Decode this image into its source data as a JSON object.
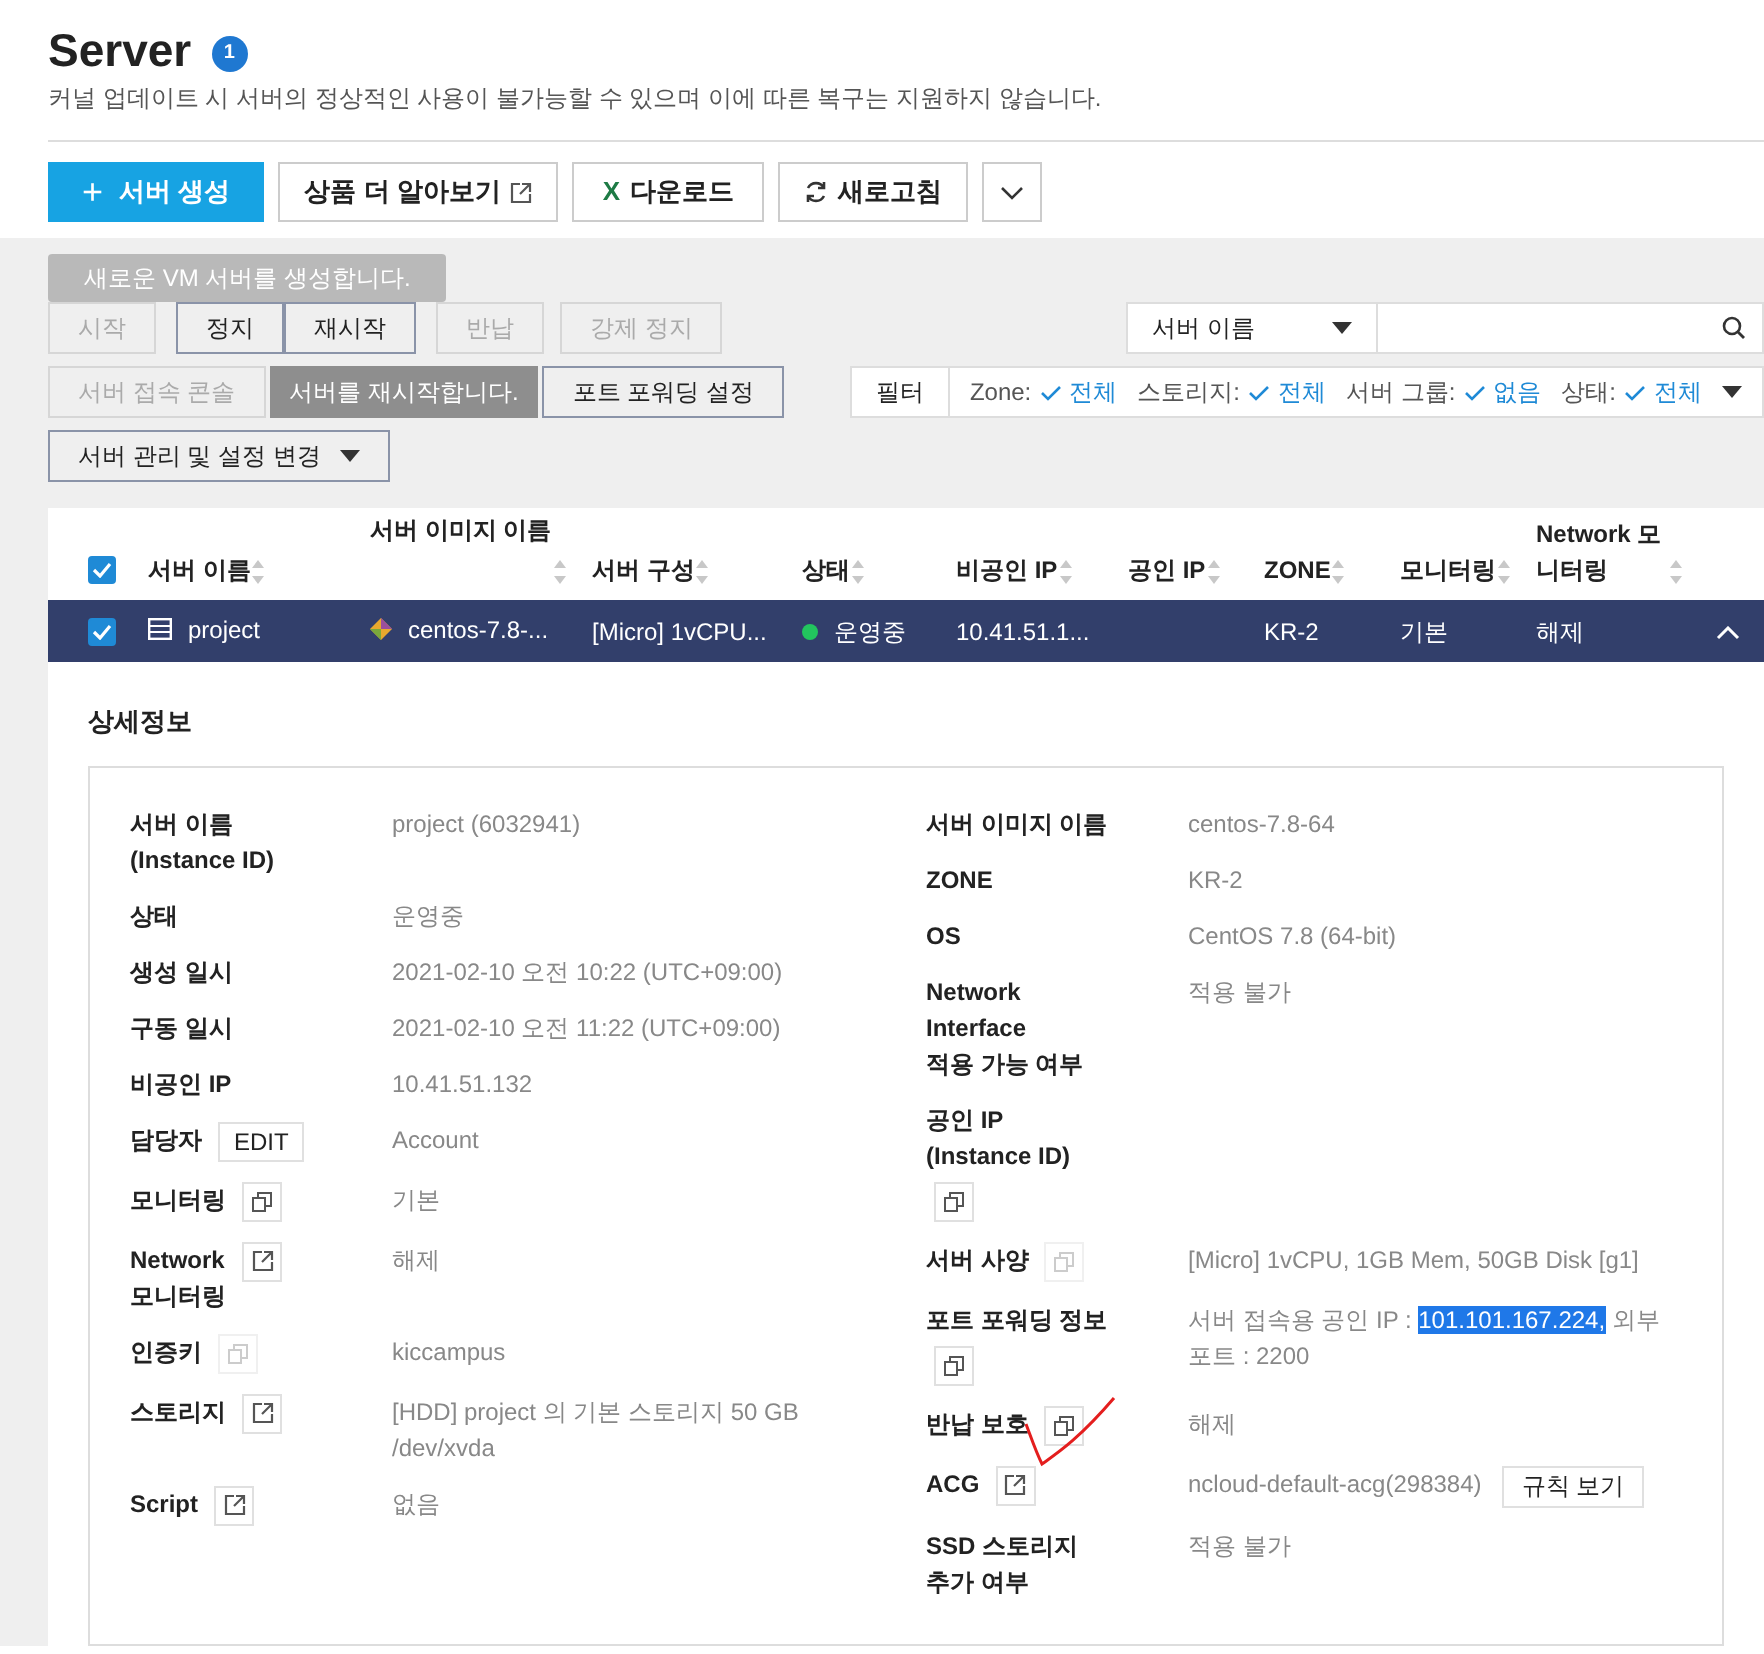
{
  "header": {
    "title": "Server",
    "badge": "1",
    "subtitle": "커널 업데이트 시 서버의 정상적인 사용이 불가능할 수 있으며 이에 따른 복구는 지원하지 않습니다."
  },
  "toolbar": [
    {
      "kind": "primary",
      "icon": "+",
      "label": "서버 생성"
    },
    {
      "kind": "external",
      "label": "상품 더 알아보기"
    },
    {
      "kind": "excel",
      "icon": "X",
      "label": "다운로드"
    },
    {
      "kind": "refresh",
      "label": "새로고침"
    },
    {
      "kind": "caret"
    }
  ],
  "tooltip": "새로운 VM 서버를 생성합니다.",
  "actions": [
    [
      {
        "label": "시작",
        "disabled": true
      },
      {
        "label": "정지",
        "disabled": false
      },
      {
        "label": "재시작",
        "disabled": false
      },
      {
        "label": "반납",
        "disabled": true
      },
      {
        "label": "강제 정지",
        "disabled": true
      }
    ],
    [
      {
        "label": "서버 접속 콘솔",
        "disabled": true
      },
      {
        "kind": "tooltip",
        "label": "서버를 재시작합니다."
      },
      {
        "label": "포트 포워딩 설정",
        "disabled": false
      }
    ],
    [
      {
        "label": "서버 관리 및 설정 변경",
        "disabled": false,
        "kind": "dropdown"
      }
    ]
  ],
  "search": {
    "select": "서버 이름"
  },
  "filter": {
    "label": "필터",
    "items": [
      {
        "name": "Zone:",
        "value": "전체"
      },
      {
        "name": "스토리지:",
        "value": "전체"
      },
      {
        "name": "서버 그룹:",
        "value": "없음"
      },
      {
        "name": "상태:",
        "value": "전체"
      }
    ]
  },
  "table": {
    "all_checked": true,
    "columns": [
      "서버 이름",
      "서버 이미지 이름",
      "서버 구성",
      "상태",
      "비공인 IP",
      "공인 IP",
      "ZONE",
      "모니터링",
      "Network 모니터링"
    ],
    "rows": [
      {
        "checked": true,
        "selected": true,
        "expanded": true,
        "cells": [
          "project",
          "centos-7.8-...",
          "[Micro] 1vCPU...",
          "운영중",
          "10.41.51.1...",
          "",
          "KR-2",
          "기본",
          "해제"
        ],
        "color": "#22c55e"
      }
    ]
  },
  "details": {
    "title": "상세정보",
    "left": [
      {
        "label": "서버 이름\n(Instance ID)",
        "value": [
          {
            "text": "project (6032941)"
          }
        ]
      },
      {
        "label": "상태",
        "value": [
          {
            "text": "운영중"
          }
        ]
      },
      {
        "label": "생성 일시",
        "value": [
          {
            "text": "2021-02-10 오전 10:22 (UTC+09:00)"
          }
        ]
      },
      {
        "label": "구동 일시",
        "value": [
          {
            "text": "2021-02-10 오전 11:22 (UTC+09:00)"
          }
        ]
      },
      {
        "label": "비공인 IP",
        "value": [
          {
            "text": "10.41.51.132"
          }
        ]
      },
      {
        "label": "담당자",
        "action": {
          "kind": "edit",
          "text": "EDIT",
          "disabled": false
        },
        "value": [
          {
            "text": "Account"
          }
        ]
      },
      {
        "label": "모니터링",
        "action": {
          "kind": "copy",
          "disabled": false
        },
        "value": [
          {
            "text": "기본"
          }
        ]
      },
      {
        "label": "Network\n모니터링",
        "action": {
          "kind": "external",
          "disabled": false
        },
        "value": [
          {
            "text": "해제"
          }
        ]
      },
      {
        "label": "인증키",
        "action": {
          "kind": "copy",
          "disabled": true
        },
        "value": [
          {
            "text": "kiccampus"
          }
        ]
      },
      {
        "label": "스토리지",
        "action": {
          "kind": "external",
          "disabled": false
        },
        "value": [
          {
            "text": "[HDD] project 의 기본 스토리지  50 GB\n/dev/xvda"
          }
        ]
      },
      {
        "label": "Script",
        "action": {
          "kind": "external",
          "disabled": false
        },
        "value": [
          {
            "text": "없음"
          }
        ]
      }
    ],
    "right": [
      {
        "label": "서버 이미지 이름",
        "value": [
          {
            "text": "centos-7.8-64"
          }
        ]
      },
      {
        "label": "ZONE",
        "value": [
          {
            "text": "KR-2"
          }
        ]
      },
      {
        "label": "OS",
        "value": [
          {
            "text": "CentOS 7.8 (64-bit)"
          }
        ]
      },
      {
        "label": "Network\nInterface\n적용 가능 여부",
        "value": [
          {
            "text": "적용 불가"
          }
        ]
      },
      {
        "label": "공인 IP\n(Instance ID)",
        "action": {
          "kind": "copy",
          "disabled": false
        }
      },
      {
        "label": "서버 사양",
        "action": {
          "kind": "copy",
          "disabled": true
        },
        "value": [
          {
            "text": "[Micro] 1vCPU, 1GB Mem, 50GB Disk [g1]"
          }
        ]
      },
      {
        "label": "포트 포워딩 정보",
        "action": {
          "kind": "copy",
          "disabled": false,
          "below": true
        },
        "value": [
          {
            "text": "서버 접속용 공인 IP : ",
            "selected": false
          },
          {
            "text": "101.101.167.224,",
            "selected": true
          },
          {
            "text": " 외부 포트 : 2200",
            "selected": false
          }
        ]
      },
      {
        "label": "반납 보호",
        "action": {
          "kind": "copy",
          "disabled": false
        },
        "value": [
          {
            "text": "해제"
          }
        ]
      },
      {
        "label": "ACG",
        "action": {
          "kind": "external",
          "disabled": false
        },
        "value": [
          {
            "text": "ncloud-default-acg(298384)"
          }
        ],
        "button": "규칙 보기"
      },
      {
        "label": "SSD 스토리지\n추가 여부",
        "value": [
          {
            "text": "적용 불가"
          }
        ]
      }
    ]
  }
}
